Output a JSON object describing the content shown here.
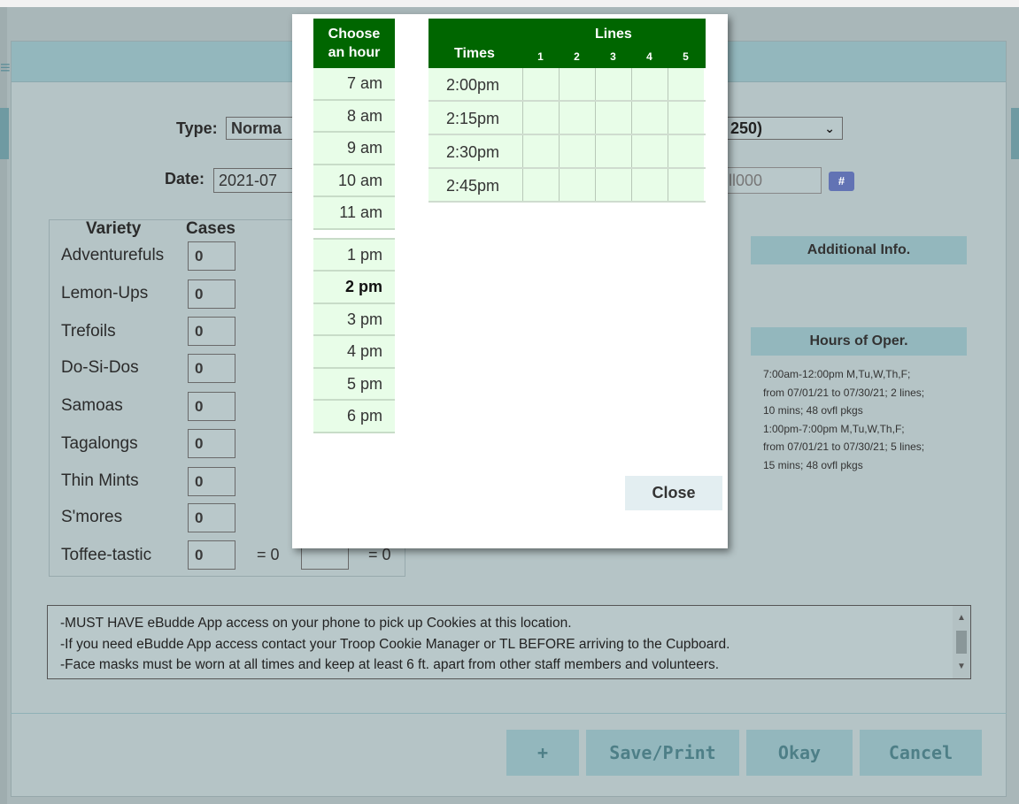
{
  "form": {
    "type_label": "Type:",
    "type_value": "Norma",
    "type_select_partial": "250)",
    "date_label": "Date:",
    "date_value": "2021-07",
    "order_field_partial": "ll000",
    "hash_label": "#",
    "variety_header": "Variety",
    "cases_header": "Cases",
    "varieties": [
      {
        "name": "Adventurefuls",
        "cases": "0"
      },
      {
        "name": "Lemon-Ups",
        "cases": "0"
      },
      {
        "name": "Trefoils",
        "cases": "0"
      },
      {
        "name": "Do-Si-Dos",
        "cases": "0"
      },
      {
        "name": "Samoas",
        "cases": "0"
      },
      {
        "name": "Tagalongs",
        "cases": "0"
      },
      {
        "name": "Thin Mints",
        "cases": "0"
      },
      {
        "name": "S'mores",
        "cases": "0"
      },
      {
        "name": "Toffee-tastic",
        "cases": "0"
      }
    ],
    "total_eq": "= 0",
    "total_eq2": "= 0"
  },
  "side": {
    "additional_info": "Additional Info.",
    "hours_header": "Hours of Oper.",
    "hours_lines": [
      "7:00am-12:00pm M,Tu,W,Th,F;",
      "from 07/01/21 to 07/30/21; 2 lines;",
      "10 mins; 48 ovfl pkgs",
      "1:00pm-7:00pm M,Tu,W,Th,F;",
      "from 07/01/21 to 07/30/21; 5 lines;",
      "15 mins; 48 ovfl pkgs"
    ]
  },
  "notice": {
    "lines": [
      "-MUST HAVE eBudde App access on your phone to pick up Cookies at this location.",
      "-If you need eBudde App access contact your Troop Cookie Manager or TL BEFORE arriving to the Cupboard.",
      "-Face masks must be worn at all times and keep at least 6 ft. apart from other staff members and volunteers."
    ]
  },
  "footer": {
    "plus": "+",
    "save_print": "Save/Print",
    "okay": "Okay",
    "cancel": "Cancel"
  },
  "popup": {
    "hour_header_1": "Choose",
    "hour_header_2": "an hour",
    "am_hours": [
      "7 am",
      "8 am",
      "9 am",
      "10 am",
      "11 am"
    ],
    "pm_hours": [
      "1 pm",
      "2 pm",
      "3 pm",
      "4 pm",
      "5 pm",
      "6 pm"
    ],
    "selected_hour": "2 pm",
    "lines_label": "Lines",
    "times_label": "Times",
    "line_numbers": [
      "1",
      "2",
      "3",
      "4",
      "5"
    ],
    "times": [
      "2:00pm",
      "2:15pm",
      "2:30pm",
      "2:45pm"
    ],
    "close": "Close"
  },
  "colors": {
    "popup_header_green": "#006600",
    "cell_light_green": "#e8fde8",
    "dialog_header": "#93b7bd"
  }
}
